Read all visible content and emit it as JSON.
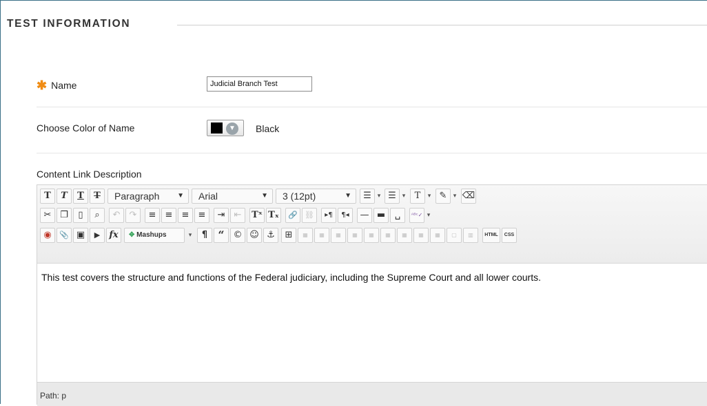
{
  "section": {
    "title": "TEST INFORMATION"
  },
  "name_field": {
    "required_marker": "✱",
    "label": "Name",
    "value": "Judicial Branch Test"
  },
  "color_field": {
    "label": "Choose Color of Name",
    "selected_color_text": "Black",
    "swatch_color": "#000000"
  },
  "description": {
    "label": "Content Link Description",
    "content_text": "This test covers the structure and functions of the Federal judiciary, including the Supreme Court and all lower courts.",
    "path_label": "Path: p"
  },
  "toolbar": {
    "row1": {
      "bold": "T",
      "italic": "T",
      "underline": "T",
      "strikethrough": "T",
      "format_select": "Paragraph",
      "font_select": "Arial",
      "size_select": "3 (12pt)",
      "bullet_list": "☰",
      "numbered_list": "☰",
      "text_color": "T",
      "highlight": "✎",
      "eraser": "⌫"
    },
    "row2": {
      "cut": "✂",
      "copy": "❐",
      "paste": "▯",
      "find": "⌕",
      "undo": "↶",
      "redo": "↷",
      "align_left": "≡",
      "align_center": "≡",
      "align_right": "≡",
      "justify": "≡",
      "indent": "⇥",
      "outdent": "⇤",
      "superscript": "Tˣ",
      "subscript": "Tₓ",
      "link": "🔗",
      "unlink": "⛓",
      "ltr": "▸¶",
      "rtl": "¶◂",
      "hr": "—",
      "hr_thick": "▬",
      "nbsp": "␣",
      "spellcheck": "ᴬᴮᶜ✓"
    },
    "row3": {
      "record": "◉",
      "attach": "📎",
      "image": "▣",
      "media": "▶",
      "math": "fx",
      "mashups": "Mashups",
      "paragraph_mark": "¶",
      "quote": "“",
      "copyright": "©",
      "emoticon": "☺",
      "anchor": "⚓",
      "table": "⊞",
      "html": "HTML",
      "css": "CSS"
    }
  },
  "colors": {
    "required": "#f08c14",
    "frame_border": "#3a6f86"
  }
}
